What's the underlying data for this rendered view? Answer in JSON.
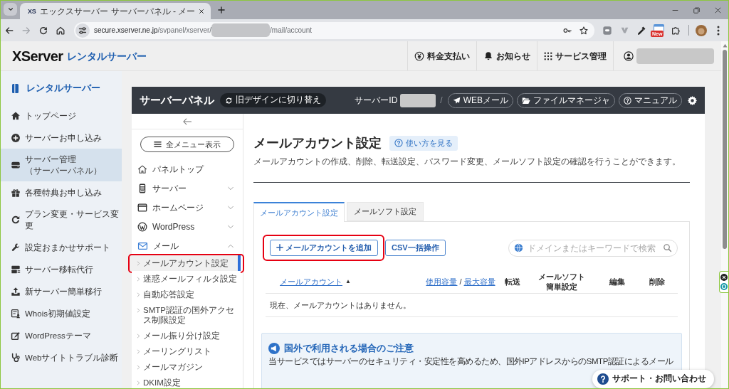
{
  "browser": {
    "tabs": [
      {
        "favicon": "XS",
        "title": "エックスサーバー サーバーパネル - メー",
        "selected": true
      }
    ],
    "address": {
      "host": "secure.xserver.ne.jp",
      "path": "/svpanel/xserver/",
      "redacted": true,
      "path_after": "/mail/account"
    },
    "extension_badge": "New"
  },
  "site_header": {
    "logo": {
      "wordmark": "XServer",
      "product": "レンタルサーバー"
    },
    "nav": [
      {
        "label": "料金支払い"
      },
      {
        "label": "お知らせ"
      },
      {
        "label": "サービス管理"
      }
    ],
    "account_redacted": true
  },
  "sidebar": {
    "title": "レンタルサーバー",
    "items": [
      {
        "label": "トップページ",
        "selected": false
      },
      {
        "label": "サーバーお申し込み",
        "selected": false
      },
      {
        "label": "サーバー管理",
        "sublabel": "（サーバーパネル）",
        "selected": true
      },
      {
        "label": "各種特典お申し込み",
        "selected": false
      },
      {
        "label": "プラン変更・サービス変更",
        "selected": false
      },
      {
        "label": "設定おまかせサポート",
        "selected": false
      },
      {
        "label": "サーバー移転代行",
        "selected": false
      },
      {
        "label": "新サーバー簡単移行",
        "selected": false
      },
      {
        "label": "Whois初期値設定",
        "selected": false
      },
      {
        "label": "WordPressテーマ",
        "selected": false
      },
      {
        "label": "Webサイトトラブル診断",
        "selected": false
      }
    ]
  },
  "server_panel": {
    "title": "サーバーパネル",
    "design_switch": "旧デザインに切り替え",
    "server_id": {
      "label": "サーバーID",
      "redacted": true
    },
    "separator": "/",
    "tools": [
      {
        "label": "WEBメール"
      },
      {
        "label": "ファイルマネージャ"
      },
      {
        "label": "マニュアル"
      }
    ]
  },
  "panel_menu": {
    "all_menu_button": "全メニュー表示",
    "top_link": {
      "label": "パネルトップ"
    },
    "groups": [
      {
        "label": "サーバー",
        "expanded": false
      },
      {
        "label": "ホームページ",
        "expanded": false
      },
      {
        "label": "WordPress",
        "expanded": false
      },
      {
        "label": "メール",
        "expanded": true,
        "children": [
          {
            "label": "メールアカウント設定",
            "selected": true,
            "highlighted": true
          },
          {
            "label": "迷惑メールフィルタ設定",
            "selected": false,
            "highlighted": false
          },
          {
            "label": "自動応答設定",
            "selected": false,
            "highlighted": false
          },
          {
            "label": "SMTP認証の国外アクセス制限設定",
            "selected": false,
            "highlighted": false
          },
          {
            "label": "メール振り分け設定",
            "selected": false,
            "highlighted": false
          },
          {
            "label": "メーリングリスト",
            "selected": false,
            "highlighted": false
          },
          {
            "label": "メールマガジン",
            "selected": false,
            "highlighted": false
          },
          {
            "label": "DKIM設定",
            "selected": false,
            "highlighted": false
          }
        ]
      }
    ]
  },
  "content": {
    "title": "メールアカウント設定",
    "help_link": "使い方を見る",
    "description": "メールアカウントの作成、削除、転送設定、パスワード変更、メールソフト設定の確認を行うことができます。",
    "tabs": [
      {
        "label": "メールアカウント設定",
        "selected": true
      },
      {
        "label": "メールソフト設定",
        "selected": false
      }
    ],
    "actions": [
      {
        "kind": "add",
        "label": "メールアカウントを追加",
        "highlighted": true
      },
      {
        "kind": "plain",
        "label": "CSV一括操作",
        "highlighted": false
      }
    ],
    "search": {
      "placeholder": "ドメインまたはキーワードで検索"
    },
    "table": {
      "columns": [
        {
          "kind": "sort_link",
          "label": "メールアカウント",
          "sort_mark": "▲"
        },
        {
          "kind": "link_pair",
          "links": [
            "使用容量",
            "最大容量"
          ],
          "separator": "/"
        },
        {
          "kind": "text",
          "label": "転送"
        },
        {
          "kind": "text",
          "label": "メールソフト簡単設定"
        },
        {
          "kind": "text",
          "label": "編集"
        },
        {
          "kind": "text",
          "label": "削除"
        }
      ],
      "empty_message": "現在、メールアカウントはありません。"
    },
    "notice": {
      "title": "国外で利用される場合のご注意",
      "text": "当サービスではサーバーのセキュリティ・安定性を高めるため、国外IPアドレスからのSMTP認証によるメール"
    }
  },
  "support_button": {
    "label": "サポート・お問い合わせ"
  }
}
